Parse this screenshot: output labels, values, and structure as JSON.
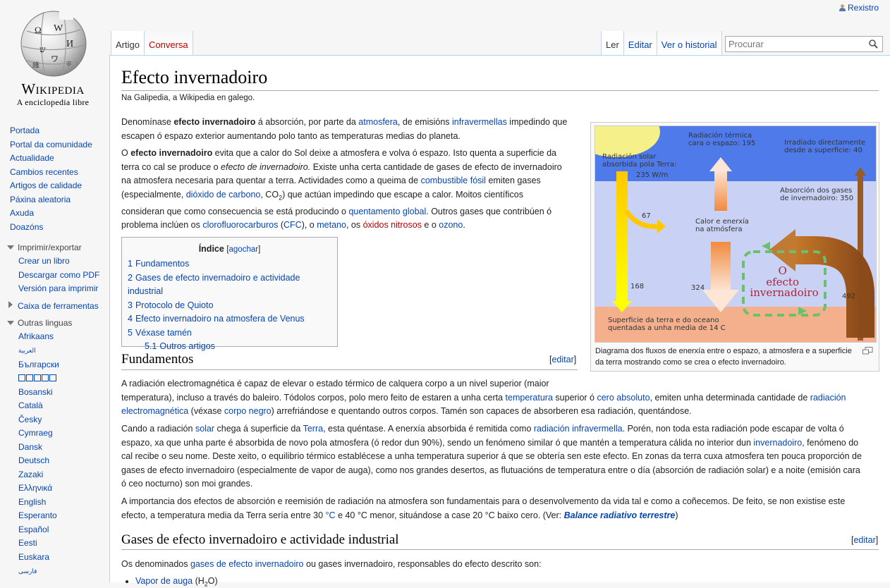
{
  "personal": {
    "register": "Rexistro"
  },
  "logo": {
    "wordmark": "Wikipedia",
    "tagline": "A enciclopedia libre"
  },
  "sidebar": {
    "nav": [
      "Portada",
      "Portal da comunidade",
      "Actualidade",
      "Cambios recentes",
      "Artigos de calidade",
      "Páxina aleatoria",
      "Axuda",
      "Doazóns"
    ],
    "print_heading": "Imprimir/exportar",
    "print_items": [
      "Crear un libro",
      "Descargar como PDF",
      "Versión para imprimir"
    ],
    "tools_heading": "Caixa de ferramentas",
    "languages_heading": "Outras linguas",
    "languages": [
      "Afrikaans",
      "العربية",
      "Български",
      "",
      "Bosanski",
      "Català",
      "Česky",
      "Cymraeg",
      "Dansk",
      "Deutsch",
      "Zazaki",
      "Ελληνικά",
      "English",
      "Esperanto",
      "Español",
      "Eesti",
      "Euskara",
      "فارسی"
    ]
  },
  "tabs": {
    "article": "Artigo",
    "talk": "Conversa",
    "read": "Ler",
    "edit": "Editar",
    "history": "Ver o historial"
  },
  "search": {
    "placeholder": "Procurar"
  },
  "article": {
    "title": "Efecto invernadoiro",
    "tagline": "Na Galipedia, a Wikipedia en galego.",
    "p1": {
      "a": "Denomínase ",
      "b": "efecto invernadoiro",
      "c": " á absorción, por parte da ",
      "l1": "atmosfera",
      "d": ", de emisións ",
      "l2": "infravermellas",
      "e": " impedindo que",
      "line2": "escapen ó espazo exterior aumentando polo tanto as temperaturas medias do planeta."
    },
    "p2": {
      "a": "O ",
      "b": "efecto invernadoiro",
      "c": " evita que a calor do Sol deixe a atmosfera e volva ó espazo. Isto quenta a superficie da",
      "line2a": "terra co cal se produce o ",
      "line2i": "efecto de invernadoiro.",
      "line2b": " Existe unha certa cantidade de gases de efecto de invernadoiro",
      "line3a": "na atmosfera necesaria para quentar a terra. Actividades como a queima de ",
      "line3l": "combustible fósil",
      "line3b": " emiten gases",
      "line4a": "(especialmente, ",
      "line4l": "dióxido de carbono",
      "line4b": ", CO",
      "line4sub": "2",
      "line4c": ") que actúan impedindo que escape a calor. Moitos científicos",
      "line5a": "consideran que como consecuencia se está producindo o ",
      "line5l": "quentamento global",
      "line5b": ". Outros gases que contribúen ó",
      "line6a": "problema inclúen os ",
      "line6l1": "clorofluorocarburos",
      "line6b": " (",
      "line6l2": "CFC",
      "line6c": "), o ",
      "line6l3": "metano",
      "line6d": ", os ",
      "line6l4": "óxidos nitrosos",
      "line6e": " e o ",
      "line6l5": "ozono",
      "line6f": "."
    },
    "toc": {
      "title": "Índice",
      "toggle": "agochar",
      "items": [
        {
          "num": "1",
          "label": "Fundamentos"
        },
        {
          "num": "2",
          "label": "Gases de efecto invernadoiro e actividade industrial"
        },
        {
          "num": "3",
          "label": "Protocolo de Quioto"
        },
        {
          "num": "4",
          "label": "Efecto invernadoiro na atmosfera de Venus"
        },
        {
          "num": "5",
          "label": "Véxase tamén"
        },
        {
          "num": "5.1",
          "label": "Outros artigos"
        }
      ]
    },
    "section1": {
      "heading": "Fundamentos",
      "edit": "editar",
      "p1a": "A radiación electromagnética é capaz de elevar o estado térmico de calquera corpo a un nivel superior (maior",
      "p1b1": "temperatura), incluso a través do baleiro. Tódolos corpos, polo mero feito de estaren a unha certa ",
      "p1b_l1": "temperatura",
      "p1b2": " superior ó ",
      "p1b_l2": "cero absoluto",
      "p1b3": ", emiten unha determinada cantidade de ",
      "p1b_l3": "radiación",
      "p1c_l1": "electromagnética",
      "p1c1": " (véxase ",
      "p1c_l2": "corpo negro",
      "p1c2": ") arrefriándose e quentando outros corpos. Tamén son capaces de absorberen esa radiación, quentándose.",
      "p2a1": "Cando a radiación ",
      "p2a_l1": "solar",
      "p2a2": " chega á superficie da ",
      "p2a_l2": "Terra",
      "p2a3": ", esta quéntase. A enerxía absorbida é remitida como ",
      "p2a_l3": "radiación infravermella",
      "p2a4": ". Porén, non toda esta radiación pode escapar de volta ó",
      "p2b1": "espazo, xa que unha parte é absorbida de novo pola atmosfera (ó redor dun 90%), sendo un fenómeno similar ó que mantén a temperatura cálida no interior dun ",
      "p2b_l1": "invernadoiro",
      "p2b2": ", fenómeno do",
      "p2c": "cal recibe o seu nome. Deste xeito, o equilibrio térmico establécese a unha temperatura superior á que se obtería sen este efecto. En zonas da terra cuxa atmosfera ten pouca proporción de",
      "p2d": "gases de efecto invernadoiro (especialmente de vapor de auga), como nos grandes desertos, as flutuacións de temperatura entre o día (absorción de radiación solar) e a noite (emisión cara",
      "p2e": "ó ceo nocturno) son moi grandes.",
      "p3a": "A importancia dos efectos de absorción e reemisión de radiación na atmosfera son fundamentais para o desenvolvemento da vida tal e como a coñecemos. De feito, se non existise este",
      "p3b1": "efecto, a temperatura media da Terra sería entre 30 ",
      "p3b_l1": "°C",
      "p3b2": " e 40 °C menor, situándose a case 20 °C baixo cero. (Ver: ",
      "p3b_l2": "Balance radiativo terrestre",
      "p3b3": ")"
    },
    "section2": {
      "heading": "Gases de efecto invernadoiro e actividade industrial",
      "edit": "editar",
      "p1a": "Os denominados ",
      "p1_l1": "gases de efecto invernadoiro",
      "p1b": " ou gases invernadoiro, responsables do efecto descrito son:",
      "li1_l": "Vapor de auga",
      "li1": " (H",
      "li1sub": "2",
      "li1b": "O)"
    },
    "figure": {
      "caption": "Diagrama dos fluxos de enerxía entre o espazo, a atmosfera e a superficie da terra mostrando como se crea o efecto invernadoiro.",
      "labels": {
        "thermal": "Radiación térmica",
        "thermal2": "cara o espazo: 195",
        "irradiated": "Irradiado directamente",
        "irradiated2": "desde a superficie: 40",
        "solar": "Radiación solar",
        "solar2": "absorbida pola Terra:",
        "solar3": "235 W/m",
        "absorption": "Absorción dos gases",
        "absorption2": "de invernadoiro: 350",
        "heat": "Calor e enerxía",
        "heat2": "na atmósfera",
        "n67": "67",
        "n168": "168",
        "n324": "324",
        "n492": "492",
        "effect1": "O",
        "effect2": "efecto",
        "effect3": "invernadoiro",
        "surface": "Superficie da terra e do oceano",
        "surface2": "quentadas a unha media de 14 C"
      }
    }
  }
}
